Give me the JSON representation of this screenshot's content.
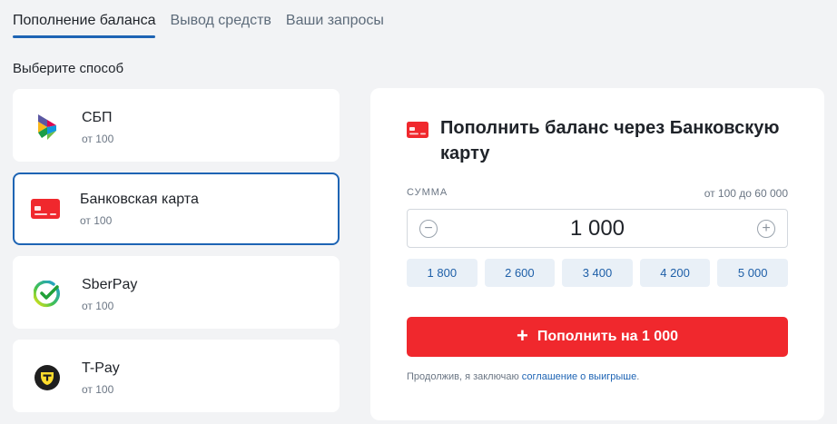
{
  "tabs": [
    {
      "label": "Пополнение баланса",
      "active": true
    },
    {
      "label": "Вывод средств",
      "active": false
    },
    {
      "label": "Ваши запросы",
      "active": false
    }
  ],
  "section_title": "Выберите способ",
  "methods": [
    {
      "name": "СБП",
      "sub": "от 100",
      "icon": "sbp-icon",
      "selected": false
    },
    {
      "name": "Банковская карта",
      "sub": "от 100",
      "icon": "bank-card-icon",
      "selected": true
    },
    {
      "name": "SberPay",
      "sub": "от 100",
      "icon": "sberpay-icon",
      "selected": false
    },
    {
      "name": "T-Pay",
      "sub": "от 100",
      "icon": "tpay-icon",
      "selected": false
    }
  ],
  "panel": {
    "title": "Пополнить баланс через Банковскую карту",
    "sum_label": "СУММА",
    "sum_range": "от 100 до 60 000",
    "amount": "1 000",
    "presets": [
      "1 800",
      "2 600",
      "3 400",
      "4 200",
      "5 000"
    ],
    "submit_plus": "+",
    "submit_label": "Пополнить на 1 000",
    "agreement_text": "Продолжив, я заключаю ",
    "agreement_link": "соглашение о выигрыше",
    "agreement_end": "."
  },
  "colors": {
    "accent": "#1e64b4",
    "submit": "#f0282d",
    "preset_bg": "#e9f0f7"
  }
}
